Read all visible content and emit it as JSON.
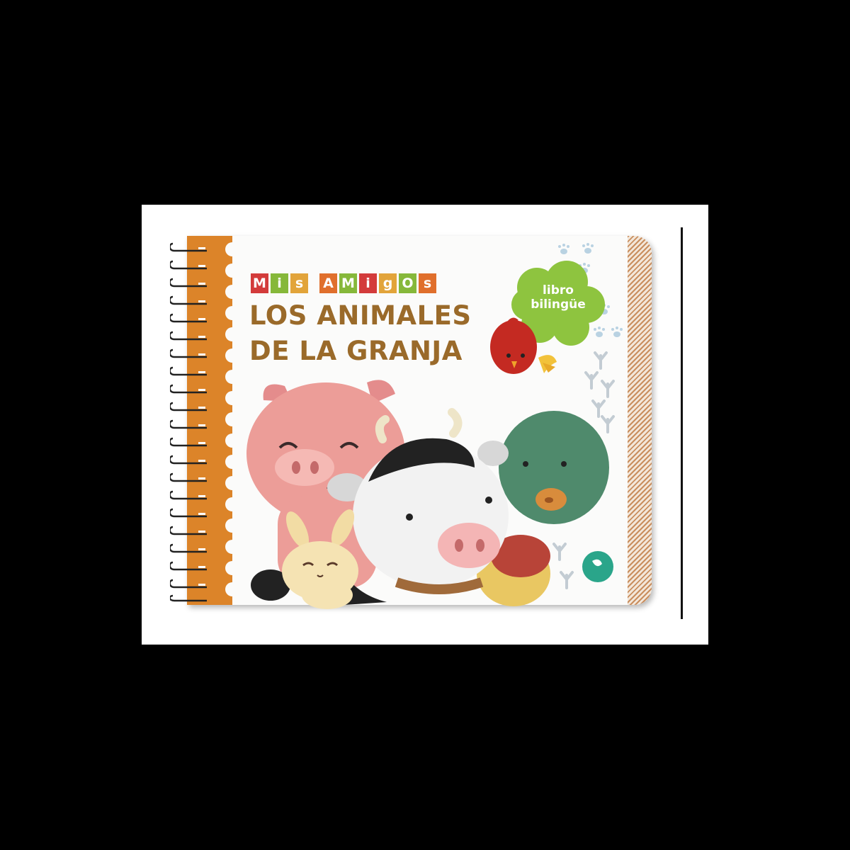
{
  "book": {
    "series": [
      "M",
      "i",
      "s",
      "A",
      "M",
      "i",
      "g",
      "O",
      "s"
    ],
    "title_line1": "LOS ANIMALES",
    "title_line2": "DE LA GRANJA",
    "badge_line1": "libro",
    "badge_line2": "bilingüe"
  },
  "colors": {
    "background": "#000000",
    "cover": "#fbfbfa",
    "spine": "#dc8429",
    "title": "#9a6a2a",
    "badge": "#8ec43f"
  },
  "illustration": [
    "pig",
    "cow",
    "duck",
    "bunny",
    "bird",
    "footprints"
  ]
}
